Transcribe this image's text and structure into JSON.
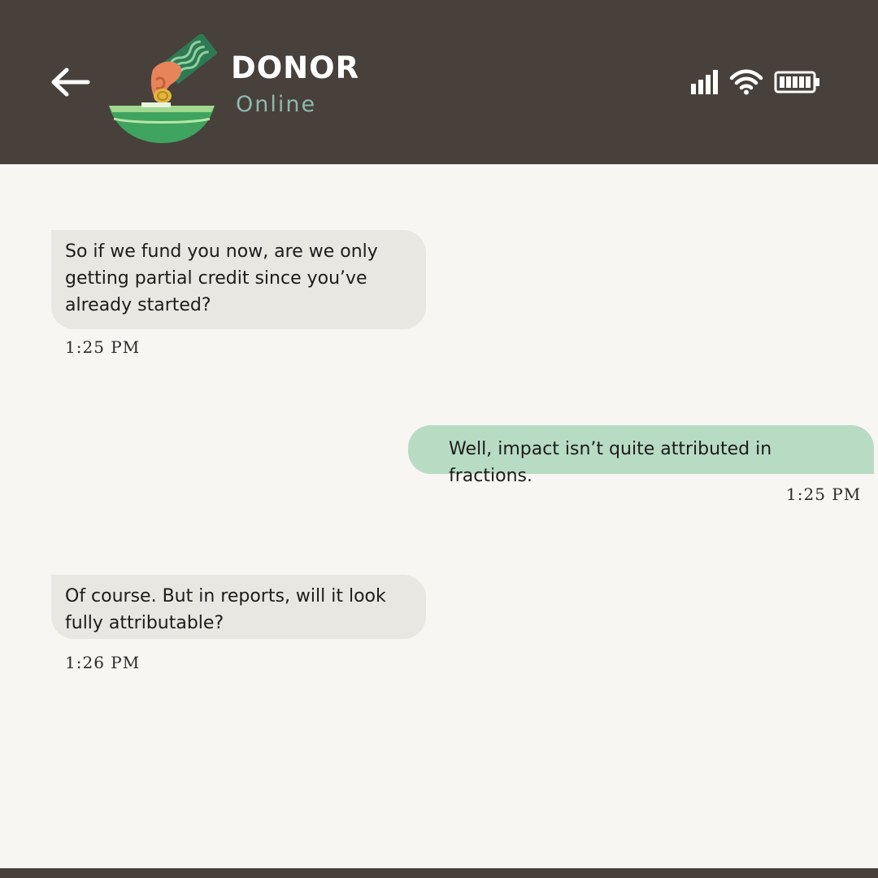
{
  "header": {
    "contact_name": "DONOR",
    "contact_status": "Online",
    "background": "#48403b",
    "status_color": "#8fb8ae"
  },
  "icons": {
    "back": "left-arrow-icon",
    "logo": "donation-hand-coin-bowl-logo",
    "signal": "signal-bars-icon",
    "wifi": "wifi-icon",
    "battery": "battery-full-icon"
  },
  "messages": [
    {
      "direction": "incoming",
      "text": "So if we fund you now, are we only getting partial credit since you’ve already started?",
      "time": "1:25 PM"
    },
    {
      "direction": "outgoing",
      "text": "Well, impact isn’t quite attributed in fractions.",
      "time": "1:25 PM"
    },
    {
      "direction": "incoming",
      "text": "Of course. But in reports, will it look fully attributable?",
      "time": "1:26 PM"
    }
  ],
  "colors": {
    "incoming_bubble": "#e8e7e1",
    "outgoing_bubble": "#b8dbc3",
    "chat_background": "#f7f6f2"
  }
}
